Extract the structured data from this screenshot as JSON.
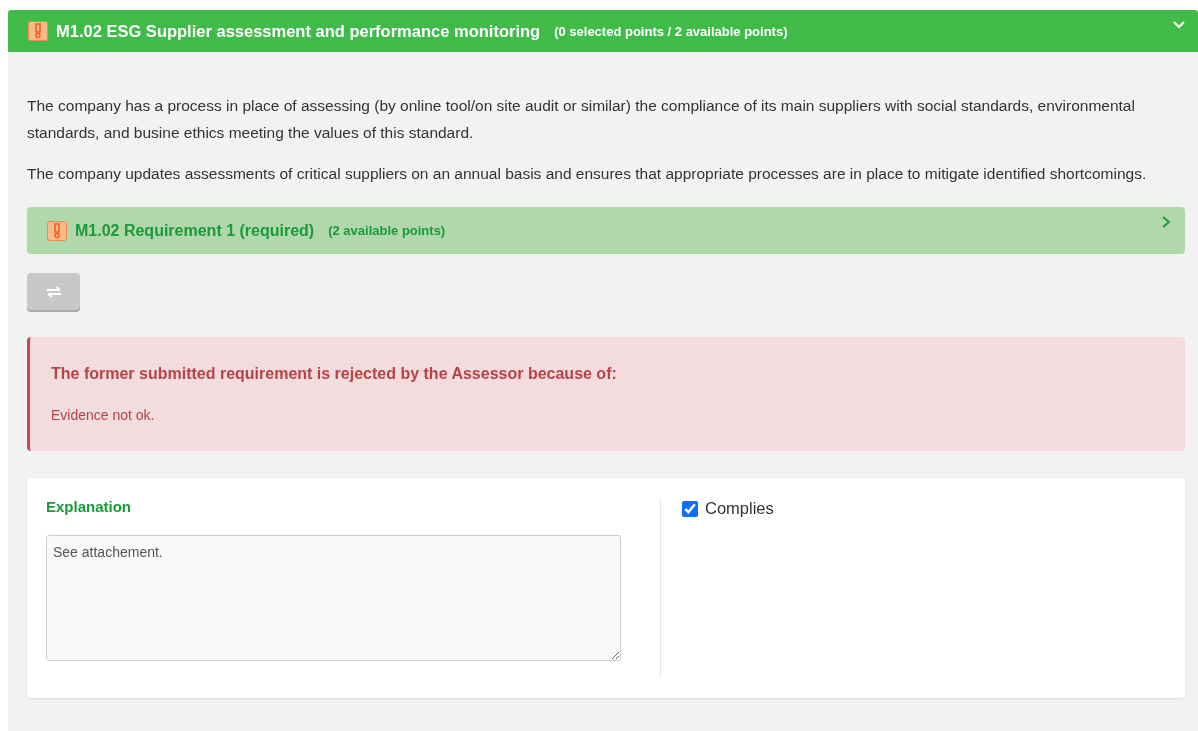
{
  "section": {
    "title": "M1.02 ESG Supplier assessment and performance monitoring",
    "points": "(0 selected points / 2 available points)",
    "expanded": true
  },
  "paragraphs": [
    "The company has a process in place of assessing (by online tool/on site audit or similar) the compliance of its main suppliers with social standards, environmental standards, and busine ethics meeting the values of this standard.",
    "The company updates assessments of critical suppliers on an annual basis and ensures that appropriate processes are in place to mitigate identified shortcomings."
  ],
  "requirement": {
    "title": "M1.02 Requirement 1 (required)",
    "points": "(2 available points)",
    "expanded": false
  },
  "alert": {
    "title": "The former submitted requirement is rejected by the Assessor because of:",
    "message": "Evidence not ok."
  },
  "form": {
    "label": "Explanation",
    "value": "See attachement.",
    "checkbox": {
      "label": "Complies",
      "checked": true
    }
  }
}
